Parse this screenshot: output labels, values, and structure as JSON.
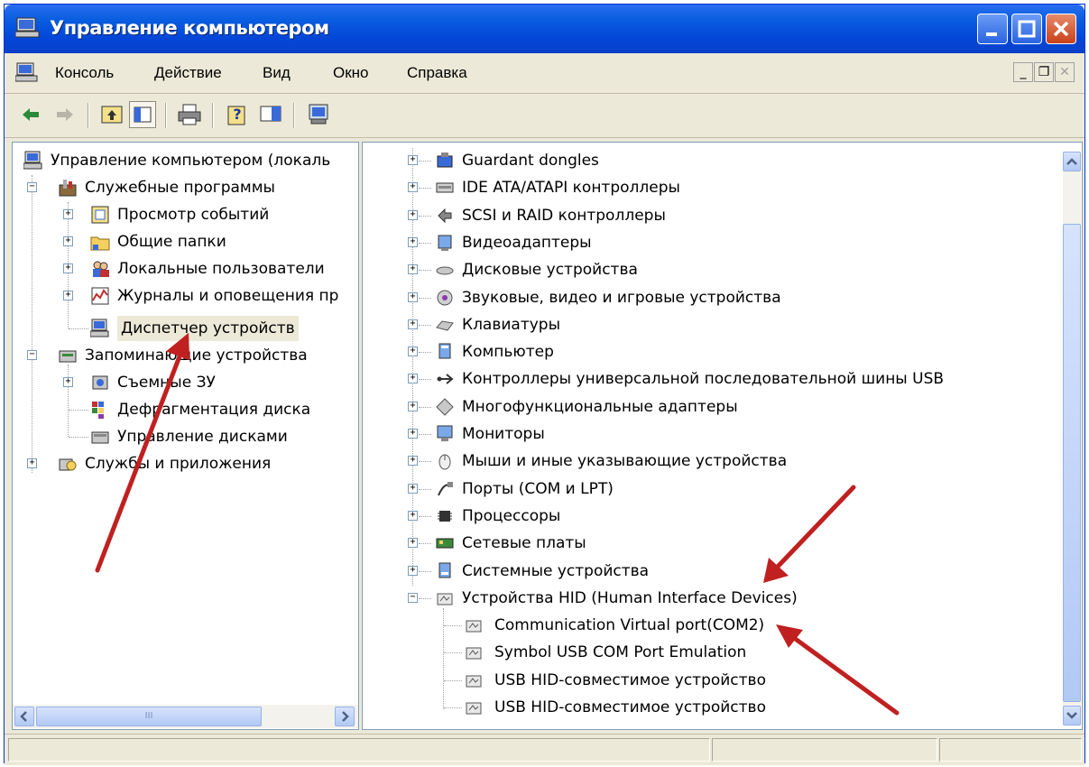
{
  "window": {
    "title": "Управление компьютером"
  },
  "menubar": {
    "items": [
      "Консоль",
      "Действие",
      "Вид",
      "Окно",
      "Справка"
    ]
  },
  "left_tree": {
    "root": "Управление компьютером (локаль",
    "items": [
      {
        "label": "Служебные программы",
        "icon": "tools-icon",
        "expander": "−"
      },
      {
        "label": "Просмотр событий",
        "icon": "event-viewer-icon",
        "expander": "+"
      },
      {
        "label": "Общие папки",
        "icon": "shared-folders-icon",
        "expander": "+"
      },
      {
        "label": "Локальные пользователи",
        "icon": "users-icon",
        "expander": "+"
      },
      {
        "label": "Журналы и оповещения пр",
        "icon": "performance-logs-icon",
        "expander": "+"
      },
      {
        "label": "Диспетчер устройств",
        "icon": "device-manager-icon",
        "expander": "",
        "selected": true
      },
      {
        "label": "Запоминающие устройства",
        "icon": "storage-icon",
        "expander": "−"
      },
      {
        "label": "Съемные ЗУ",
        "icon": "removable-storage-icon",
        "expander": "+"
      },
      {
        "label": "Дефрагментация диска",
        "icon": "defrag-icon",
        "expander": ""
      },
      {
        "label": "Управление дисками",
        "icon": "disk-management-icon",
        "expander": ""
      },
      {
        "label": "Службы и приложения",
        "icon": "services-icon",
        "expander": "+"
      }
    ]
  },
  "right_tree": {
    "items": [
      {
        "label": "Guardant dongles",
        "icon": "dongle-icon"
      },
      {
        "label": "IDE ATA/ATAPI контроллеры",
        "icon": "ide-controller-icon"
      },
      {
        "label": "SCSI и RAID контроллеры",
        "icon": "scsi-controller-icon"
      },
      {
        "label": "Видеоадаптеры",
        "icon": "display-adapter-icon"
      },
      {
        "label": "Дисковые устройства",
        "icon": "disk-drive-icon"
      },
      {
        "label": "Звуковые, видео и игровые устройства",
        "icon": "sound-icon"
      },
      {
        "label": "Клавиатуры",
        "icon": "keyboard-icon"
      },
      {
        "label": "Компьютер",
        "icon": "computer-icon"
      },
      {
        "label": "Контроллеры универсальной последовательной шины USB",
        "icon": "usb-icon"
      },
      {
        "label": "Многофункциональные адаптеры",
        "icon": "multifunction-adapter-icon"
      },
      {
        "label": "Мониторы",
        "icon": "monitor-icon"
      },
      {
        "label": "Мыши и иные указывающие устройства",
        "icon": "mouse-icon"
      },
      {
        "label": "Порты (COM и LPT)",
        "icon": "port-icon"
      },
      {
        "label": "Процессоры",
        "icon": "processor-icon"
      },
      {
        "label": "Сетевые платы",
        "icon": "network-card-icon"
      },
      {
        "label": "Системные устройства",
        "icon": "system-device-icon"
      },
      {
        "label": "Устройства HID (Human Interface Devices)",
        "icon": "hid-icon",
        "expanded": true
      }
    ],
    "hid_children": [
      "Communication Virtual port(COM2)",
      "Symbol USB COM Port Emulation",
      "USB HID-совместимое устройство",
      "USB HID-совместимое устройство"
    ]
  },
  "hscroll": {
    "thumb_label": "III"
  },
  "colors": {
    "title_bar": "#0a5ee0",
    "annotation_arrow": "#c02020",
    "selection": "#ece9d8"
  }
}
